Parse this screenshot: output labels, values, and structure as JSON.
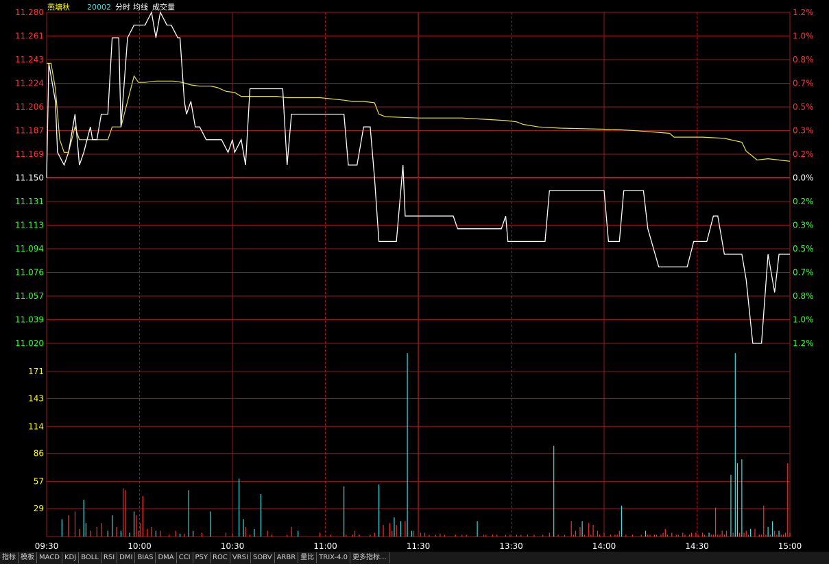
{
  "header": {
    "stock_name": "燕塘秋",
    "code": "20002",
    "menu": [
      "分时",
      "均线",
      "成交量"
    ]
  },
  "colors": {
    "background": "#000000",
    "grid": "#9b1c1c",
    "price_line": "#ffffff",
    "avg_line": "#e8e04a",
    "up": "#ff3232",
    "down": "#32ff32",
    "neutral": "#ffffff",
    "vol_label": "#ffff00",
    "vol_up": "#ff3232",
    "vol_down": "#40e0e0",
    "name_color": "#ffff00",
    "code_color": "#40e0e0"
  },
  "chart_data": {
    "type": "line",
    "x_ticks": [
      "09:30",
      "10:00",
      "10:30",
      "11:00",
      "11:30",
      "13:30",
      "14:00",
      "14:30",
      "15:00"
    ],
    "price_axis": {
      "left_labels": [
        "11.280",
        "11.261",
        "11.243",
        "11.224",
        "11.206",
        "11.187",
        "11.169",
        "11.150",
        "11.131",
        "11.113",
        "11.094",
        "11.076",
        "11.057",
        "11.039",
        "11.020"
      ],
      "right_labels": [
        "1.2%",
        "1.0%",
        "0.8%",
        "0.7%",
        "0.5%",
        "0.3%",
        "0.2%",
        "0.0%",
        "0.2%",
        "0.3%",
        "0.5%",
        "0.7%",
        "0.8%",
        "1.0%",
        "1.2%"
      ],
      "ylim": [
        11.02,
        11.28
      ],
      "prev_close": 11.15
    },
    "volume_axis": {
      "labels": [
        "171",
        "143",
        "114",
        "86",
        "57",
        "29"
      ],
      "ylim": [
        0,
        200
      ]
    },
    "series": [
      {
        "values": [
          [
            0,
            11.15
          ],
          [
            1,
            11.24
          ],
          [
            4,
            11.21
          ],
          [
            5,
            11.17
          ],
          [
            8,
            11.16
          ],
          [
            10,
            11.17
          ],
          [
            13,
            11.2
          ],
          [
            15,
            11.16
          ],
          [
            17,
            11.17
          ],
          [
            20,
            11.19
          ],
          [
            21,
            11.18
          ],
          [
            23,
            11.18
          ],
          [
            25,
            11.2
          ],
          [
            28,
            11.2
          ],
          [
            30,
            11.26
          ],
          [
            33,
            11.26
          ],
          [
            34,
            11.19
          ],
          [
            37,
            11.26
          ],
          [
            40,
            11.27
          ],
          [
            45,
            11.27
          ],
          [
            48,
            11.28
          ],
          [
            50,
            11.26
          ],
          [
            52,
            11.28
          ],
          [
            55,
            11.27
          ],
          [
            57,
            11.27
          ],
          [
            60,
            11.26
          ],
          [
            61,
            11.26
          ],
          [
            63,
            11.21
          ],
          [
            64,
            11.2
          ],
          [
            66,
            11.21
          ],
          [
            68,
            11.19
          ],
          [
            70,
            11.19
          ],
          [
            73,
            11.18
          ],
          [
            80,
            11.18
          ],
          [
            83,
            11.17
          ],
          [
            85,
            11.18
          ],
          [
            86,
            11.17
          ],
          [
            89,
            11.18
          ],
          [
            91,
            11.16
          ],
          [
            93,
            11.22
          ],
          [
            108,
            11.22
          ],
          [
            110,
            11.16
          ],
          [
            112,
            11.2
          ],
          [
            136,
            11.2
          ],
          [
            138,
            11.16
          ],
          [
            142,
            11.16
          ],
          [
            145,
            11.19
          ],
          [
            148,
            11.19
          ],
          [
            150,
            11.15
          ],
          [
            152,
            11.1
          ],
          [
            160,
            11.1
          ],
          [
            163,
            11.16
          ],
          [
            164,
            11.12
          ],
          [
            186,
            11.12
          ],
          [
            188,
            11.11
          ],
          [
            208,
            11.11
          ],
          [
            210,
            11.12
          ],
          [
            211,
            11.1
          ],
          [
            228,
            11.1
          ],
          [
            230,
            11.14
          ],
          [
            255,
            11.14
          ],
          [
            257,
            11.1
          ],
          [
            262,
            11.1
          ],
          [
            264,
            11.14
          ],
          [
            273,
            11.14
          ],
          [
            275,
            11.11
          ],
          [
            280,
            11.08
          ],
          [
            293,
            11.08
          ],
          [
            296,
            11.1
          ],
          [
            302,
            11.1
          ],
          [
            305,
            11.12
          ],
          [
            307,
            11.12
          ],
          [
            310,
            11.09
          ],
          [
            318,
            11.09
          ],
          [
            320,
            11.07
          ],
          [
            323,
            11.02
          ],
          [
            327,
            11.02
          ],
          [
            330,
            11.09
          ],
          [
            333,
            11.06
          ],
          [
            335,
            11.09
          ],
          [
            340,
            11.09
          ]
        ]
      },
      {
        "values": [
          [
            0,
            11.24
          ],
          [
            2,
            11.24
          ],
          [
            4,
            11.22
          ],
          [
            6,
            11.18
          ],
          [
            8,
            11.17
          ],
          [
            10,
            11.17
          ],
          [
            13,
            11.19
          ],
          [
            15,
            11.18
          ],
          [
            20,
            11.18
          ],
          [
            24,
            11.18
          ],
          [
            28,
            11.18
          ],
          [
            30,
            11.19
          ],
          [
            34,
            11.19
          ],
          [
            37,
            11.21
          ],
          [
            40,
            11.23
          ],
          [
            42,
            11.225
          ],
          [
            45,
            11.225
          ],
          [
            50,
            11.226
          ],
          [
            55,
            11.226
          ],
          [
            58,
            11.226
          ],
          [
            62,
            11.225
          ],
          [
            66,
            11.223
          ],
          [
            70,
            11.222
          ],
          [
            75,
            11.222
          ],
          [
            78,
            11.221
          ],
          [
            82,
            11.218
          ],
          [
            86,
            11.217
          ],
          [
            89,
            11.214
          ],
          [
            95,
            11.214
          ],
          [
            105,
            11.214
          ],
          [
            110,
            11.213
          ],
          [
            125,
            11.213
          ],
          [
            136,
            11.211
          ],
          [
            140,
            11.21
          ],
          [
            145,
            11.21
          ],
          [
            150,
            11.209
          ],
          [
            152,
            11.2
          ],
          [
            155,
            11.198
          ],
          [
            170,
            11.197
          ],
          [
            190,
            11.197
          ],
          [
            200,
            11.196
          ],
          [
            210,
            11.195
          ],
          [
            215,
            11.194
          ],
          [
            218,
            11.192
          ],
          [
            225,
            11.19
          ],
          [
            235,
            11.189
          ],
          [
            260,
            11.188
          ],
          [
            270,
            11.187
          ],
          [
            285,
            11.185
          ],
          [
            287,
            11.182
          ],
          [
            300,
            11.182
          ],
          [
            310,
            11.181
          ],
          [
            318,
            11.178
          ],
          [
            320,
            11.171
          ],
          [
            325,
            11.164
          ],
          [
            330,
            11.165
          ],
          [
            340,
            11.163
          ]
        ]
      }
    ],
    "volume": [
      [
        7,
        18,
        "down"
      ],
      [
        10,
        22,
        "up"
      ],
      [
        13,
        26,
        "up"
      ],
      [
        15,
        8,
        "up"
      ],
      [
        17,
        38,
        "down"
      ],
      [
        18,
        14,
        "down"
      ],
      [
        20,
        6,
        "up"
      ],
      [
        23,
        10,
        "up"
      ],
      [
        25,
        14,
        "up"
      ],
      [
        28,
        6,
        "down"
      ],
      [
        30,
        22,
        "down"
      ],
      [
        32,
        10,
        "up"
      ],
      [
        34,
        6,
        "down"
      ],
      [
        35,
        50,
        "up"
      ],
      [
        36,
        48,
        "up"
      ],
      [
        38,
        4,
        "down"
      ],
      [
        40,
        26,
        "down"
      ],
      [
        41,
        22,
        "up"
      ],
      [
        42,
        6,
        "up"
      ],
      [
        43,
        14,
        "up"
      ],
      [
        44,
        42,
        "up"
      ],
      [
        46,
        8,
        "up"
      ],
      [
        48,
        10,
        "up"
      ],
      [
        50,
        6,
        "down"
      ],
      [
        52,
        6,
        "up"
      ],
      [
        56,
        2,
        "up"
      ],
      [
        59,
        6,
        "up"
      ],
      [
        61,
        3,
        "down"
      ],
      [
        63,
        3,
        "up"
      ],
      [
        65,
        48,
        "down"
      ],
      [
        67,
        6,
        "down"
      ],
      [
        71,
        4,
        "up"
      ],
      [
        75,
        26,
        "down"
      ],
      [
        82,
        4,
        "up"
      ],
      [
        85,
        3,
        "up"
      ],
      [
        88,
        60,
        "down"
      ],
      [
        90,
        18,
        "down"
      ],
      [
        91,
        10,
        "up"
      ],
      [
        93,
        2,
        "up"
      ],
      [
        95,
        8,
        "down"
      ],
      [
        98,
        44,
        "down"
      ],
      [
        101,
        6,
        "up"
      ],
      [
        103,
        2,
        "up"
      ],
      [
        110,
        2,
        "up"
      ],
      [
        112,
        10,
        "up"
      ],
      [
        115,
        6,
        "down"
      ],
      [
        125,
        4,
        "up"
      ],
      [
        130,
        2,
        "up"
      ],
      [
        137,
        2,
        "up"
      ],
      [
        140,
        2,
        "up"
      ],
      [
        143,
        2,
        "down"
      ],
      [
        148,
        2,
        "up"
      ],
      [
        152,
        54,
        "down"
      ],
      [
        158,
        6,
        "up"
      ],
      [
        160,
        12,
        "up"
      ],
      [
        162,
        16,
        "down"
      ],
      [
        165,
        190,
        "down"
      ],
      [
        167,
        6,
        "down"
      ],
      [
        173,
        4,
        "up"
      ],
      [
        180,
        3,
        "up"
      ],
      [
        190,
        2,
        "up"
      ],
      [
        200,
        2,
        "up"
      ],
      [
        210,
        2,
        "up"
      ],
      [
        215,
        2,
        "up"
      ],
      [
        220,
        2,
        "up"
      ],
      [
        230,
        4,
        "up"
      ],
      [
        245,
        16,
        "down"
      ],
      [
        260,
        2,
        "up"
      ],
      [
        278,
        2,
        "up"
      ],
      [
        288,
        2,
        "up"
      ],
      [
        295,
        2,
        "up"
      ],
      [
        305,
        2,
        "up"
      ],
      [
        310,
        2,
        "up"
      ],
      [
        315,
        2,
        "up"
      ],
      [
        321,
        2,
        "up"
      ],
      [
        326,
        2,
        "up"
      ],
      [
        331,
        2,
        "up"
      ],
      [
        334,
        2,
        "up"
      ],
      [
        337,
        2,
        "up"
      ],
      [
        322,
        2,
        "up"
      ],
      [
        240,
        16,
        "up"
      ],
      [
        242,
        6,
        "up"
      ],
      [
        244,
        10,
        "up"
      ],
      [
        248,
        14,
        "up"
      ],
      [
        250,
        12,
        "up"
      ],
      [
        252,
        6,
        "up"
      ],
      [
        255,
        4,
        "up"
      ],
      [
        263,
        32,
        "down"
      ],
      [
        278,
        2,
        "up"
      ],
      [
        283,
        8,
        "up"
      ],
      [
        297,
        4,
        "up"
      ],
      [
        303,
        4,
        "down"
      ],
      [
        316,
        76,
        "down"
      ],
      [
        322,
        8,
        "down"
      ],
      [
        324,
        8,
        "up"
      ],
      [
        327,
        2,
        "up"
      ],
      [
        331,
        2,
        "up"
      ],
      [
        333,
        6,
        "up"
      ],
      [
        335,
        6,
        "down"
      ],
      [
        338,
        4,
        "up"
      ],
      [
        340,
        4,
        "up"
      ],
      [
        274,
        6,
        "down"
      ],
      [
        282,
        4,
        "up"
      ],
      [
        286,
        4,
        "up"
      ],
      [
        291,
        4,
        "up"
      ],
      [
        295,
        4,
        "up"
      ],
      [
        300,
        4,
        "up"
      ],
      [
        306,
        30,
        "up"
      ],
      [
        309,
        6,
        "up"
      ],
      [
        311,
        6,
        "up"
      ],
      [
        313,
        64,
        "down"
      ],
      [
        314,
        4,
        "up"
      ],
      [
        315,
        190,
        "down"
      ],
      [
        317,
        4,
        "up"
      ],
      [
        318,
        80,
        "down"
      ],
      [
        319,
        4,
        "up"
      ],
      [
        320,
        6,
        "up"
      ],
      [
        328,
        32,
        "up"
      ],
      [
        330,
        10,
        "down"
      ],
      [
        332,
        16,
        "down"
      ],
      [
        339,
        76,
        "up"
      ],
      [
        232,
        94,
        "down"
      ],
      [
        262,
        6,
        "up"
      ],
      [
        275,
        2,
        "up"
      ],
      [
        286,
        2,
        "up"
      ],
      [
        294,
        2,
        "up"
      ],
      [
        304,
        2,
        "up"
      ],
      [
        307,
        2,
        "up"
      ],
      [
        310,
        2,
        "up"
      ],
      [
        324,
        2,
        "up"
      ],
      [
        326,
        2,
        "up"
      ],
      [
        329,
        2,
        "up"
      ],
      [
        336,
        2,
        "up"
      ],
      [
        136,
        52,
        "down"
      ],
      [
        141,
        6,
        "up"
      ],
      [
        143,
        2,
        "up"
      ],
      [
        148,
        2,
        "up"
      ],
      [
        150,
        4,
        "up"
      ],
      [
        154,
        12,
        "up"
      ],
      [
        157,
        14,
        "up"
      ],
      [
        159,
        20,
        "down"
      ],
      [
        164,
        16,
        "up"
      ],
      [
        168,
        6,
        "up"
      ],
      [
        171,
        4,
        "up"
      ],
      [
        173,
        2,
        "up"
      ],
      [
        175,
        2,
        "up"
      ],
      [
        178,
        2,
        "up"
      ],
      [
        182,
        2,
        "up"
      ],
      [
        187,
        2,
        "up"
      ],
      [
        192,
        2,
        "up"
      ],
      [
        197,
        16,
        "down"
      ],
      [
        201,
        2,
        "up"
      ],
      [
        204,
        2,
        "up"
      ],
      [
        206,
        2,
        "up"
      ],
      [
        212,
        2,
        "up"
      ],
      [
        217,
        2,
        "up"
      ],
      [
        223,
        2,
        "up"
      ],
      [
        227,
        2,
        "up"
      ],
      [
        234,
        2,
        "up"
      ],
      [
        237,
        2,
        "up"
      ],
      [
        241,
        2,
        "up"
      ],
      [
        246,
        2,
        "up"
      ],
      [
        249,
        2,
        "up"
      ],
      [
        253,
        2,
        "up"
      ],
      [
        258,
        2,
        "up"
      ],
      [
        261,
        2,
        "up"
      ],
      [
        265,
        2,
        "up"
      ],
      [
        268,
        2,
        "up"
      ],
      [
        272,
        2,
        "up"
      ],
      [
        276,
        2,
        "up"
      ],
      [
        279,
        2,
        "up"
      ],
      [
        281,
        2,
        "up"
      ],
      [
        284,
        2,
        "up"
      ],
      [
        289,
        2,
        "up"
      ],
      [
        292,
        2,
        "up"
      ],
      [
        298,
        2,
        "up"
      ],
      [
        301,
        2,
        "up"
      ],
      [
        305,
        2,
        "up"
      ],
      [
        308,
        2,
        "up"
      ]
    ],
    "grid": true
  },
  "toolbar": {
    "items": [
      "指标",
      "模板",
      "MACD",
      "KDJ",
      "BOLL",
      "RSI",
      "DMI",
      "BIAS",
      "DMA",
      "CCI",
      "PSY",
      "ROC",
      "VRSI",
      "SOBV",
      "ARBR",
      "量比",
      "TRIX-4.0",
      "更多指标..."
    ]
  }
}
